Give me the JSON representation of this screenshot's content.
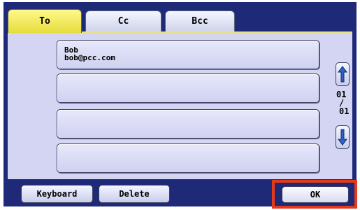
{
  "tabs": [
    {
      "label": "To",
      "active": true
    },
    {
      "label": "Cc",
      "active": false
    },
    {
      "label": "Bcc",
      "active": false
    }
  ],
  "addresses": [
    {
      "name": "Bob",
      "email": "bob@pcc.com"
    },
    {
      "name": "",
      "email": ""
    },
    {
      "name": "",
      "email": ""
    },
    {
      "name": "",
      "email": ""
    }
  ],
  "pager": {
    "current": "01",
    "separator": "/",
    "total": "01"
  },
  "icons": {
    "up": "arrow-up-icon",
    "down": "arrow-down-icon"
  },
  "footer": {
    "keyboard_label": "Keyboard",
    "delete_label": "Delete",
    "ok_label": "OK"
  },
  "colors": {
    "frame": "#1e2a77",
    "panel": "#d4d5f3",
    "active_tab": "#fff98a",
    "arrow": "#2f62c9",
    "highlight": "#e43a1a"
  }
}
